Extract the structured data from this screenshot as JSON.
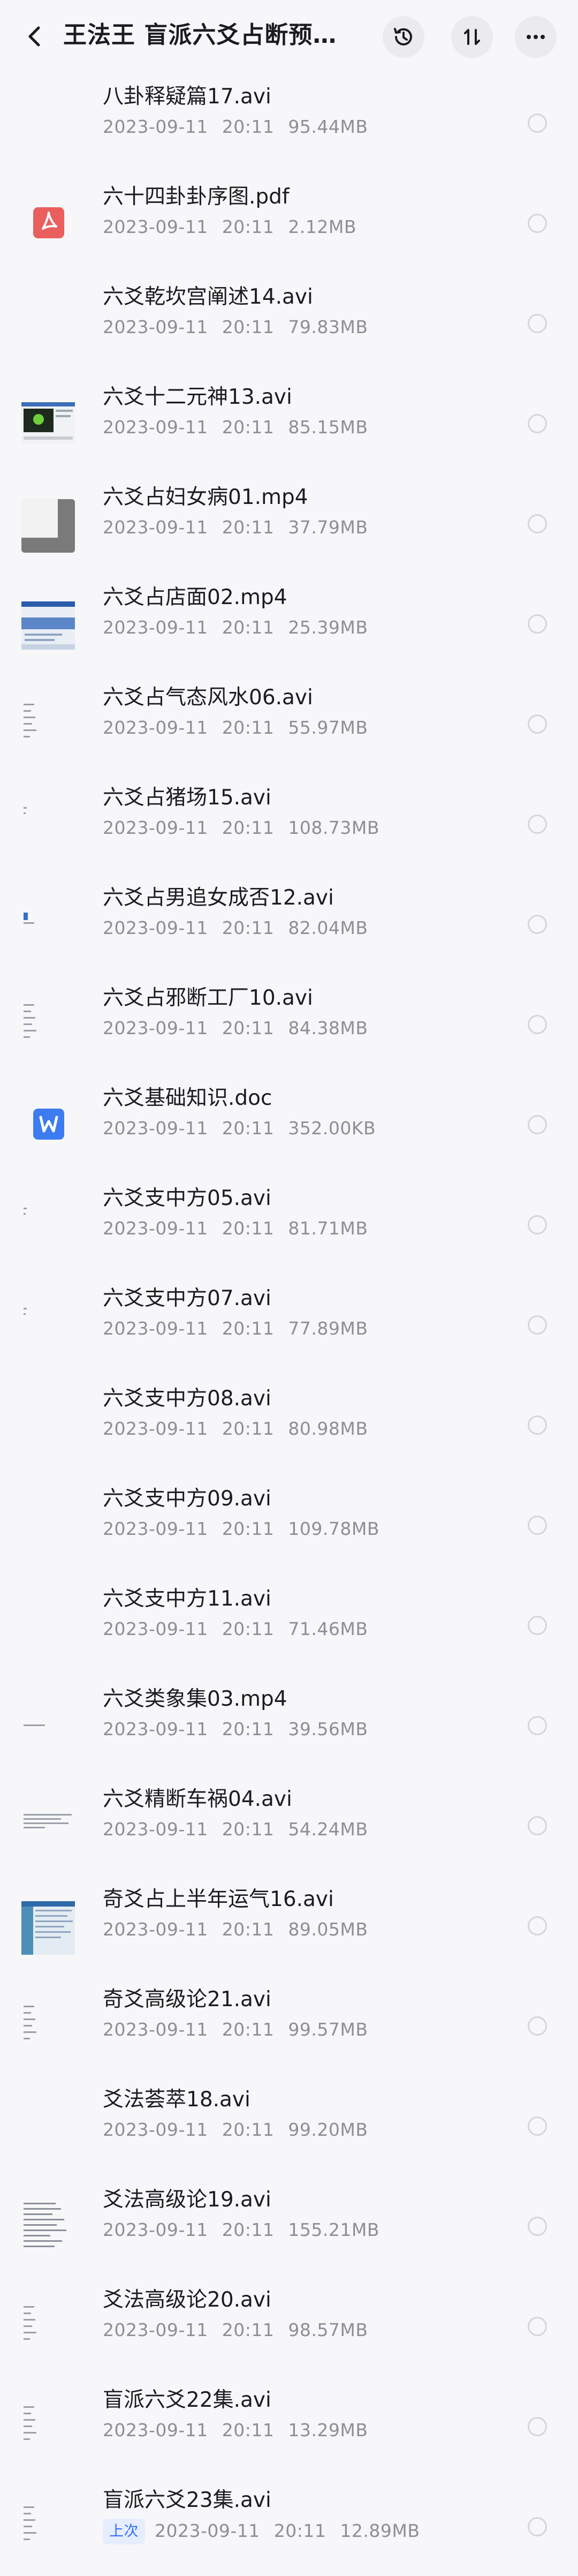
{
  "header": {
    "title": "王法王  盲派六爻占断预…"
  },
  "files": [
    {
      "name": "八卦释疑篇17.avi",
      "date": "2023-09-11",
      "time": "20:11",
      "size": "95.44MB",
      "thumb": "none"
    },
    {
      "name": "六十四卦卦序图.pdf",
      "date": "2023-09-11",
      "time": "20:11",
      "size": "2.12MB",
      "thumb": "pdf"
    },
    {
      "name": "六爻乾坎宫阐述14.avi",
      "date": "2023-09-11",
      "time": "20:11",
      "size": "79.83MB",
      "thumb": "none"
    },
    {
      "name": "六爻十二元神13.avi",
      "date": "2023-09-11",
      "time": "20:11",
      "size": "85.15MB",
      "thumb": "screen-green"
    },
    {
      "name": "六爻占妇女病01.mp4",
      "date": "2023-09-11",
      "time": "20:11",
      "size": "37.79MB",
      "thumb": "gray-block"
    },
    {
      "name": "六爻占店面02.mp4",
      "date": "2023-09-11",
      "time": "20:11",
      "size": "25.39MB",
      "thumb": "screen-blue"
    },
    {
      "name": "六爻占气态风水06.avi",
      "date": "2023-09-11",
      "time": "20:11",
      "size": "55.97MB",
      "thumb": "doc-lines"
    },
    {
      "name": "六爻占猪场15.avi",
      "date": "2023-09-11",
      "time": "20:11",
      "size": "108.73MB",
      "thumb": "dot"
    },
    {
      "name": "六爻占男追女成否12.avi",
      "date": "2023-09-11",
      "time": "20:11",
      "size": "82.04MB",
      "thumb": "dot-blue"
    },
    {
      "name": "六爻占邪断工厂10.avi",
      "date": "2023-09-11",
      "time": "20:11",
      "size": "84.38MB",
      "thumb": "doc-lines"
    },
    {
      "name": "六爻基础知识.doc",
      "date": "2023-09-11",
      "time": "20:11",
      "size": "352.00KB",
      "thumb": "word"
    },
    {
      "name": "六爻支中方05.avi",
      "date": "2023-09-11",
      "time": "20:11",
      "size": "81.71MB",
      "thumb": "dot"
    },
    {
      "name": "六爻支中方07.avi",
      "date": "2023-09-11",
      "time": "20:11",
      "size": "77.89MB",
      "thumb": "dot"
    },
    {
      "name": "六爻支中方08.avi",
      "date": "2023-09-11",
      "time": "20:11",
      "size": "80.98MB",
      "thumb": "none"
    },
    {
      "name": "六爻支中方09.avi",
      "date": "2023-09-11",
      "time": "20:11",
      "size": "109.78MB",
      "thumb": "none"
    },
    {
      "name": "六爻支中方11.avi",
      "date": "2023-09-11",
      "time": "20:11",
      "size": "71.46MB",
      "thumb": "none"
    },
    {
      "name": "六爻类象集03.mp4",
      "date": "2023-09-11",
      "time": "20:11",
      "size": "39.56MB",
      "thumb": "dash"
    },
    {
      "name": "六爻精断车祸04.avi",
      "date": "2023-09-11",
      "time": "20:11",
      "size": "54.24MB",
      "thumb": "doc-lines-wide"
    },
    {
      "name": "奇爻占上半年运气16.avi",
      "date": "2023-09-11",
      "time": "20:11",
      "size": "89.05MB",
      "thumb": "screen-table"
    },
    {
      "name": "奇爻高级论21.avi",
      "date": "2023-09-11",
      "time": "20:11",
      "size": "99.57MB",
      "thumb": "doc-lines"
    },
    {
      "name": "爻法荟萃18.avi",
      "date": "2023-09-11",
      "time": "20:11",
      "size": "99.20MB",
      "thumb": "none"
    },
    {
      "name": "爻法高级论19.avi",
      "date": "2023-09-11",
      "time": "20:11",
      "size": "155.21MB",
      "thumb": "doc-dense"
    },
    {
      "name": "爻法高级论20.avi",
      "date": "2023-09-11",
      "time": "20:11",
      "size": "98.57MB",
      "thumb": "doc-lines"
    },
    {
      "name": "盲派六爻22集.avi",
      "date": "2023-09-11",
      "time": "20:11",
      "size": "13.29MB",
      "thumb": "doc-lines"
    },
    {
      "name": "盲派六爻23集.avi",
      "date": "2023-09-11",
      "time": "20:11",
      "size": "12.89MB",
      "thumb": "doc-lines",
      "badge": "上次"
    }
  ],
  "colors": {
    "background": "#f7f7f9",
    "pdf_red": "#ea5e5e",
    "word_blue": "#3d7cf0",
    "meta_gray": "#8e8e93",
    "badge_blue": "#2f6bff"
  }
}
